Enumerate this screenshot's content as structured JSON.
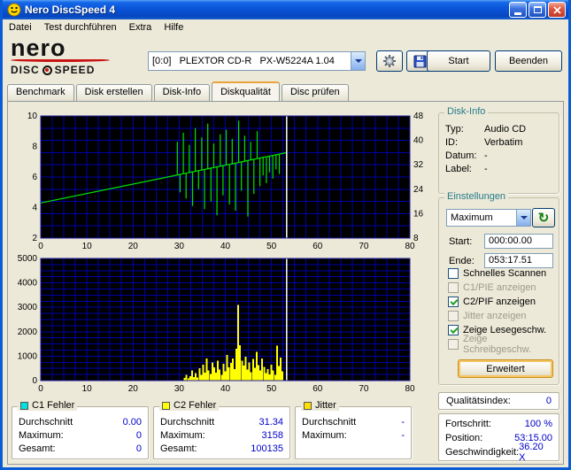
{
  "window": {
    "title": "Nero DiscSpeed 4"
  },
  "menu": {
    "items": [
      {
        "label": "Datei"
      },
      {
        "label": "Test durchführen"
      },
      {
        "label": "Extra"
      },
      {
        "label": "Hilfe"
      }
    ]
  },
  "toolbar": {
    "logo_top": "nero",
    "logo_disc": "DISC",
    "logo_speed": "SPEED",
    "drive": "[0:0]   PLEXTOR CD-R   PX-W5224A 1.04",
    "options_icon": "gear-icon",
    "save_icon": "floppy-disk-icon",
    "start_label": "Start",
    "quit_label": "Beenden"
  },
  "tabs": [
    {
      "label": "Benchmark",
      "active": false
    },
    {
      "label": "Disk erstellen",
      "active": false
    },
    {
      "label": "Disk-Info",
      "active": false
    },
    {
      "label": "Diskqualität",
      "active": true
    },
    {
      "label": "Disc prüfen",
      "active": false
    }
  ],
  "disk_info": {
    "title": "Disk-Info",
    "rows": [
      {
        "label": "Typ:",
        "value": "Audio CD"
      },
      {
        "label": "ID:",
        "value": "Verbatim"
      },
      {
        "label": "Datum:",
        "value": "-"
      },
      {
        "label": "Label:",
        "value": "-"
      }
    ]
  },
  "settings": {
    "title": "Einstellungen",
    "speed_select": "Maximum",
    "refresh_icon": "refresh-icon",
    "start_label": "Start:",
    "start_value": "000:00.00",
    "end_label": "Ende:",
    "end_value": "053:17.51",
    "checkboxes": [
      {
        "label": "Schnelles Scannen",
        "checked": false,
        "enabled": true
      },
      {
        "label": "C1/PIE anzeigen",
        "checked": false,
        "enabled": false
      },
      {
        "label": "C2/PIF anzeigen",
        "checked": true,
        "enabled": true
      },
      {
        "label": "Jitter anzeigen",
        "checked": false,
        "enabled": false
      },
      {
        "label": "Zeige Lesegeschw.",
        "checked": true,
        "enabled": true
      },
      {
        "label": "Zeige Schreibgeschw.",
        "checked": false,
        "enabled": false
      }
    ],
    "advanced_label": "Erweitert"
  },
  "quality": {
    "label": "Qualitätsindex:",
    "value": "0"
  },
  "progress": {
    "rows": [
      {
        "label": "Fortschritt:",
        "value": "100 %"
      },
      {
        "label": "Position:",
        "value": "53:15.00"
      },
      {
        "label": "Geschwindigkeit:",
        "value": "36.20 X"
      }
    ]
  },
  "error_panels": [
    {
      "title": "C1 Fehler",
      "color": "#00E0E0",
      "rows": [
        {
          "label": "Durchschnitt",
          "value": "0.00"
        },
        {
          "label": "Maximum:",
          "value": "0"
        },
        {
          "label": "Gesamt:",
          "value": "0"
        }
      ]
    },
    {
      "title": "C2 Fehler",
      "color": "#FFFF00",
      "rows": [
        {
          "label": "Durchschnitt",
          "value": "31.34"
        },
        {
          "label": "Maximum:",
          "value": "3158"
        },
        {
          "label": "Gesamt:",
          "value": "100135"
        }
      ]
    },
    {
      "title": "Jitter",
      "color": "#FFE000",
      "rows": [
        {
          "label": "Durchschnitt",
          "value": "-"
        },
        {
          "label": "Maximum:",
          "value": "-"
        }
      ]
    }
  ],
  "chart_data": [
    {
      "type": "line",
      "name": "read-speed",
      "x_min": 0,
      "x_max": 80,
      "y_min": 2,
      "y_max": 10,
      "x_ticks": [
        0,
        10,
        20,
        30,
        40,
        50,
        60,
        70,
        80
      ],
      "y_left_ticks": [
        10,
        8,
        6,
        4,
        2
      ],
      "y_right_ticks": [
        48,
        40,
        32,
        24,
        16,
        8
      ],
      "y_right_min": 8,
      "y_right_max": 48,
      "grid_x_step": 2.5,
      "grid_y_step": 0.8,
      "grid_color": "#0000A8",
      "bg_color": "#000000",
      "marker_color": "#FFFFFF",
      "marker_x": 53.3,
      "line": {
        "x0": 0,
        "v0": 4.3,
        "x1": 53.3,
        "v1": 7.6,
        "color": "#00E400"
      },
      "spikes": [
        [
          29.6,
          8.3
        ],
        [
          30.2,
          5.0
        ],
        [
          30.9,
          8.9
        ],
        [
          31.5,
          4.6
        ],
        [
          32.2,
          8.1
        ],
        [
          32.9,
          4.1
        ],
        [
          33.5,
          9.2
        ],
        [
          34.2,
          5.2
        ],
        [
          34.9,
          8.6
        ],
        [
          35.5,
          3.9
        ],
        [
          36.2,
          9.5
        ],
        [
          36.9,
          4.4
        ],
        [
          37.5,
          8.2
        ],
        [
          38.2,
          3.5
        ],
        [
          38.9,
          8.8
        ],
        [
          39.5,
          4.8
        ],
        [
          40.2,
          9.1
        ],
        [
          40.9,
          4.2
        ],
        [
          41.5,
          8.5
        ],
        [
          42.2,
          3.8
        ],
        [
          42.9,
          9.7
        ],
        [
          43.5,
          5.1
        ],
        [
          44.2,
          8.7
        ],
        [
          44.9,
          3.4
        ],
        [
          45.5,
          8.3
        ],
        [
          46.2,
          4.9
        ],
        [
          46.9,
          9.0
        ],
        [
          47.5,
          5.4
        ],
        [
          48.2,
          6.1
        ],
        [
          48.9,
          5.6
        ],
        [
          49.6,
          6.3
        ],
        [
          50.3,
          5.9
        ],
        [
          51.0,
          6.5
        ],
        [
          51.7,
          6.2
        ]
      ]
    },
    {
      "type": "bar",
      "name": "c2-errors",
      "x_min": 0,
      "x_max": 80,
      "y_min": 0,
      "y_max": 5000,
      "x_ticks": [
        0,
        10,
        20,
        30,
        40,
        50,
        60,
        70,
        80
      ],
      "y_left_ticks": [
        5000,
        4000,
        3000,
        2000,
        1000,
        0
      ],
      "grid_x_step": 2.5,
      "grid_y_step": 250,
      "grid_color": "#0000A8",
      "bg_color": "#000000",
      "marker_color": "#FFFFFF",
      "marker_x": 53.3,
      "bar_color": "#FFFF00",
      "bars": [
        [
          31.2,
          110
        ],
        [
          31.6,
          240
        ],
        [
          32.0,
          90
        ],
        [
          32.4,
          180
        ],
        [
          32.8,
          420
        ],
        [
          33.2,
          150
        ],
        [
          33.6,
          300
        ],
        [
          34.0,
          120
        ],
        [
          34.4,
          510
        ],
        [
          34.8,
          230
        ],
        [
          35.2,
          650
        ],
        [
          35.6,
          330
        ],
        [
          36.0,
          900
        ],
        [
          36.4,
          410
        ],
        [
          36.8,
          280
        ],
        [
          37.2,
          750
        ],
        [
          37.6,
          540
        ],
        [
          38.0,
          330
        ],
        [
          38.4,
          810
        ],
        [
          38.8,
          450
        ],
        [
          39.2,
          240
        ],
        [
          39.6,
          680
        ],
        [
          40.0,
          380
        ],
        [
          40.4,
          1050
        ],
        [
          40.8,
          540
        ],
        [
          41.2,
          720
        ],
        [
          41.6,
          900
        ],
        [
          42.0,
          480
        ],
        [
          42.4,
          1300
        ],
        [
          42.8,
          3100
        ],
        [
          43.2,
          1450
        ],
        [
          43.6,
          820
        ],
        [
          44.0,
          620
        ],
        [
          44.4,
          980
        ],
        [
          44.8,
          460
        ],
        [
          45.2,
          740
        ],
        [
          45.6,
          350
        ],
        [
          46.0,
          880
        ],
        [
          46.4,
          520
        ],
        [
          46.8,
          1180
        ],
        [
          47.2,
          640
        ],
        [
          47.6,
          420
        ],
        [
          48.0,
          900
        ],
        [
          48.4,
          560
        ],
        [
          48.8,
          300
        ],
        [
          49.2,
          480
        ],
        [
          49.6,
          260
        ],
        [
          50.0,
          660
        ],
        [
          50.4,
          420
        ],
        [
          50.8,
          240
        ],
        [
          51.2,
          1430
        ],
        [
          51.6,
          600
        ],
        [
          52.0,
          950
        ],
        [
          52.4,
          380
        ]
      ]
    }
  ]
}
